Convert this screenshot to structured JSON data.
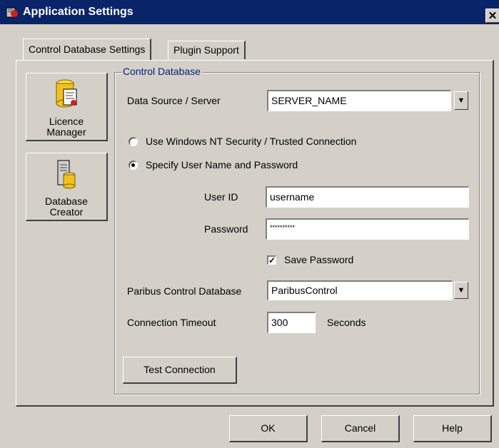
{
  "window": {
    "title": "Application Settings",
    "close_glyph": "✕"
  },
  "tabs": [
    {
      "label": "Control Database Settings",
      "active": true
    },
    {
      "label": "Plugin Support",
      "active": false
    }
  ],
  "sidebar": {
    "licence_manager": {
      "line1": "Licence",
      "line2": "Manager",
      "icon": "licence-database-icon"
    },
    "database_creator": {
      "line1": "Database",
      "line2": "Creator",
      "icon": "database-server-icon"
    }
  },
  "control_database": {
    "group_title": "Control Database",
    "data_source_label": "Data Source / Server",
    "data_source_value": "SERVER_NAME",
    "radio_windows_nt": {
      "label": "Use Windows NT Security / Trusted Connection",
      "selected": false
    },
    "radio_specify": {
      "label": "Specify User Name and Password",
      "selected": true
    },
    "user_id_label": "User ID",
    "user_id_value": "username",
    "password_label": "Password",
    "password_value": "**********",
    "save_password": {
      "label": "Save Password",
      "checked": true
    },
    "paribus_db_label": "Paribus Control Database",
    "paribus_db_value": "ParibusControl",
    "timeout_label": "Connection Timeout",
    "timeout_value": "300",
    "timeout_unit": "Seconds",
    "test_connection": "Test Connection"
  },
  "footer": {
    "ok": "OK",
    "cancel": "Cancel",
    "help": "Help"
  },
  "colors": {
    "titlebar": "#0a246a",
    "face": "#d4d0c8",
    "group_title": "#0a246a"
  }
}
